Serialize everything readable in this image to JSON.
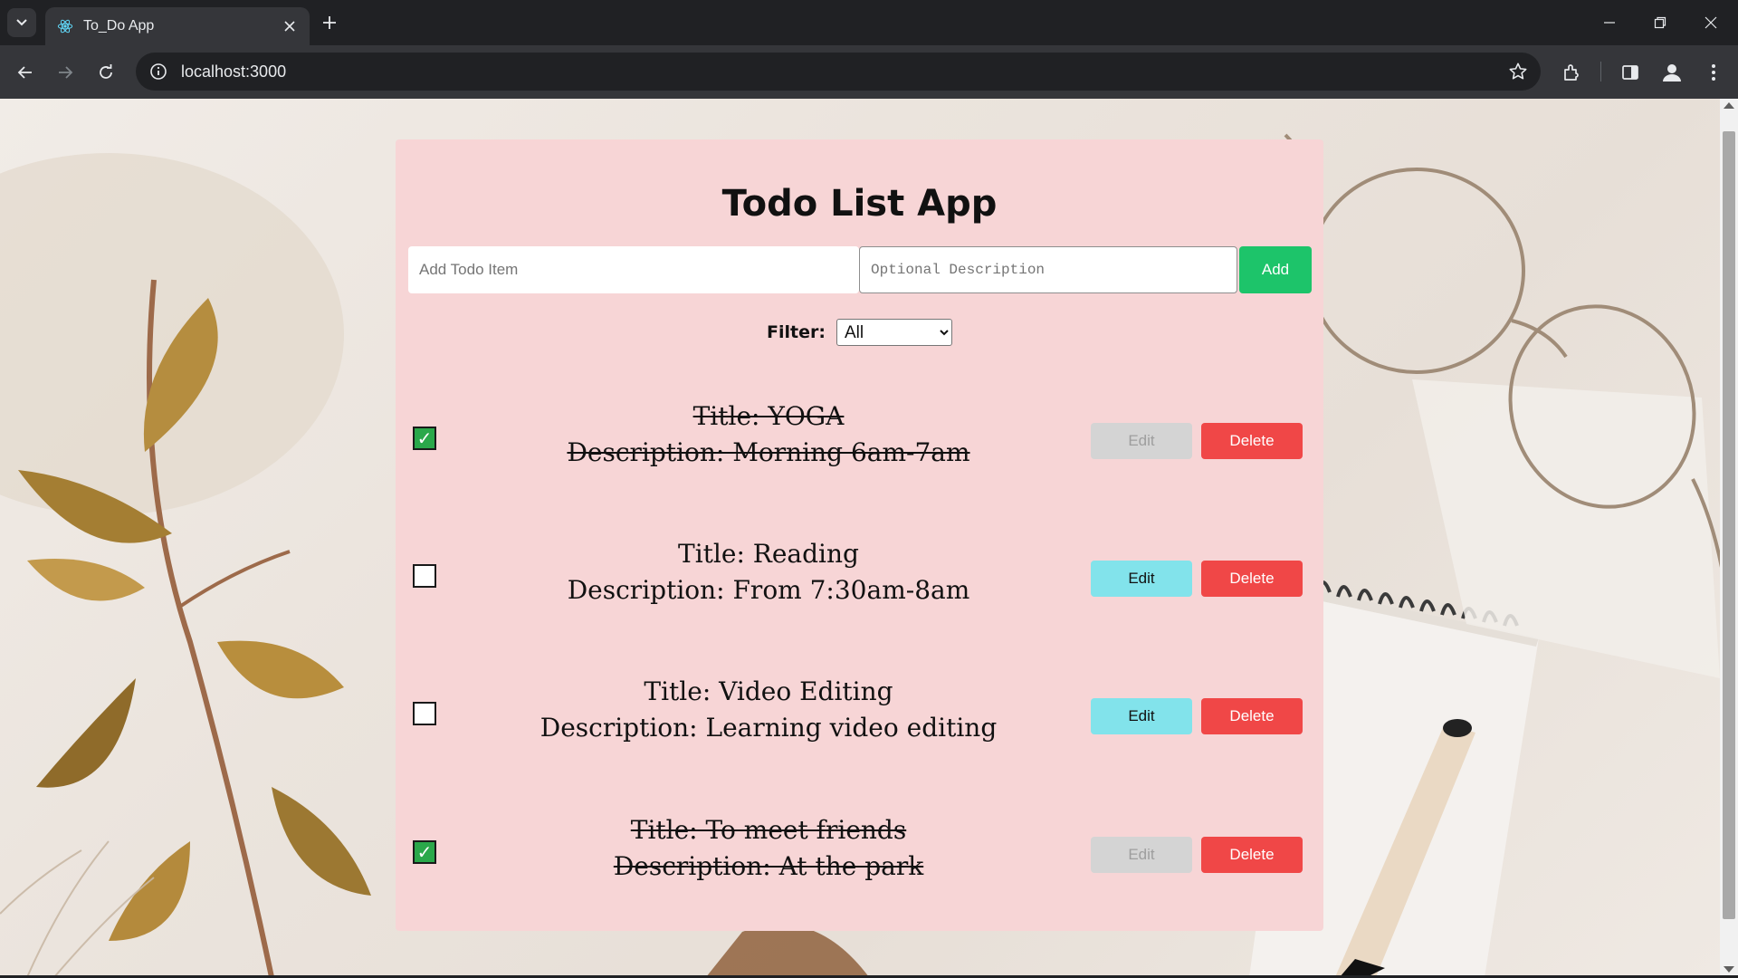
{
  "browser": {
    "tab_title": "To_Do App",
    "url": "localhost:3000"
  },
  "app": {
    "title": "Todo List App",
    "add_placeholder": "Add Todo Item",
    "desc_placeholder": "Optional Description",
    "add_label": "Add",
    "filter_label": "Filter:",
    "filter_value": "All",
    "edit_label": "Edit",
    "delete_label": "Delete",
    "todos": [
      {
        "line1": "Title: YOGA",
        "line2": "Description: Morning 6am-7am",
        "done": true
      },
      {
        "line1": "Title: Reading",
        "line2": "Description: From 7:30am-8am",
        "done": false
      },
      {
        "line1": "Title: Video Editing",
        "line2": "Description: Learning video editing",
        "done": false
      },
      {
        "line1": "Title: To meet friends",
        "line2": "Description: At the park",
        "done": true
      }
    ]
  },
  "colors": {
    "card_bg": "#f7d5d6",
    "add_button": "#1dc46a",
    "edit_button": "#82e3eb",
    "edit_disabled": "#d4d4d4",
    "delete_button": "#f04747",
    "checkbox_checked": "#2aa84a"
  }
}
